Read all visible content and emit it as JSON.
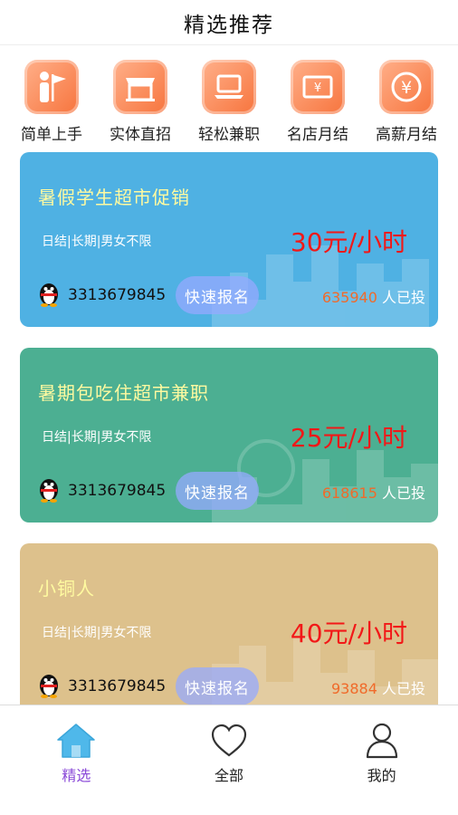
{
  "header": {
    "title": "精选推荐"
  },
  "categories": [
    {
      "label": "简单上手",
      "icon": "guide-flag-icon"
    },
    {
      "label": "实体直招",
      "icon": "storefront-icon"
    },
    {
      "label": "轻松兼职",
      "icon": "laptop-icon"
    },
    {
      "label": "名店月结",
      "icon": "yen-ticket-icon"
    },
    {
      "label": "高薪月结",
      "icon": "yen-coin-icon"
    }
  ],
  "jobs": [
    {
      "title": "暑假学生超市促销",
      "tags": "日结|长期|男女不限",
      "price": "30元/小时",
      "qq": "3313679845",
      "signup": "快速报名",
      "count": "635940",
      "count_suffix": "人已投",
      "color": "#4fb1e3"
    },
    {
      "title": "暑期包吃住超市兼职",
      "tags": "日结|长期|男女不限",
      "price": "25元/小时",
      "qq": "3313679845",
      "signup": "快速报名",
      "count": "618615",
      "count_suffix": "人已投",
      "color": "#4caf92"
    },
    {
      "title": "小铜人",
      "tags": "日结|长期|男女不限",
      "price": "40元/小时",
      "qq": "3313679845",
      "signup": "快速报名",
      "count": "93884",
      "count_suffix": "人已投",
      "color": "#ddc18c"
    }
  ],
  "tabbar": {
    "items": [
      {
        "label": "精选",
        "icon": "home-icon",
        "active": true
      },
      {
        "label": "全部",
        "icon": "heart-icon",
        "active": false
      },
      {
        "label": "我的",
        "icon": "user-icon",
        "active": false
      }
    ],
    "active_color": "#8a49d8"
  }
}
